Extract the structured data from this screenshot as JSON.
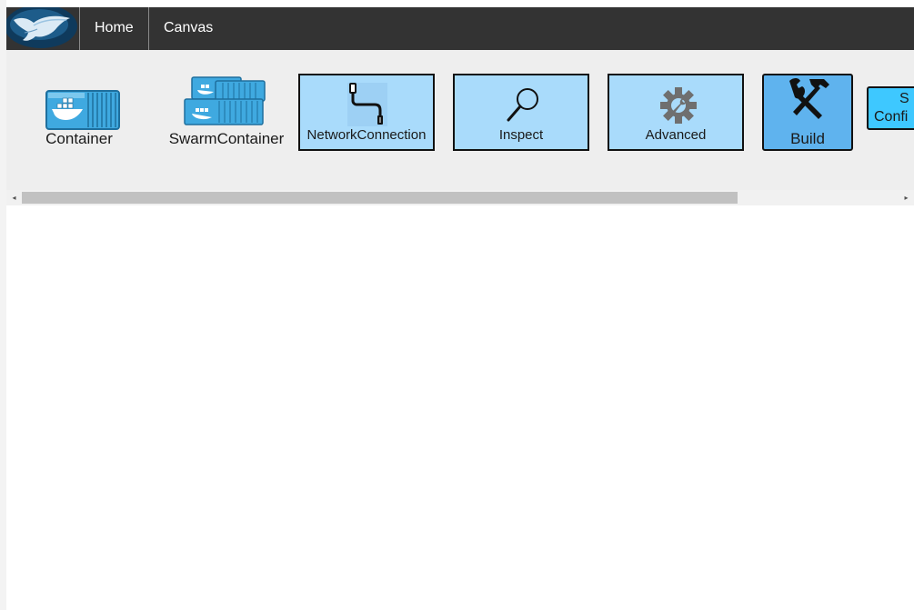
{
  "navbar": {
    "logo": "docker-whale-logo",
    "items": [
      {
        "label": "Home"
      },
      {
        "label": "Canvas"
      }
    ]
  },
  "toolbar": {
    "items": [
      {
        "label": "Container",
        "icon": "docker-container-icon"
      },
      {
        "label": "SwarmContainer",
        "icon": "swarm-container-icon"
      },
      {
        "label": "NetworkConnection",
        "icon": "network-cable-icon"
      },
      {
        "label": "Inspect",
        "icon": "magnifier-icon"
      },
      {
        "label": "Advanced",
        "icon": "gear-wrench-icon"
      },
      {
        "label": "Build",
        "icon": "hammer-wrench-icon"
      },
      {
        "label_line1": "S",
        "label_line2": "Confi"
      }
    ]
  },
  "colors": {
    "navbar": "#333333",
    "toolbar": "#eeeeee",
    "tool_box": "#a9dbfb",
    "build_box": "#5fb3ee",
    "cut_box": "#3ec8ff",
    "container_blue": "#3fa9e0"
  }
}
